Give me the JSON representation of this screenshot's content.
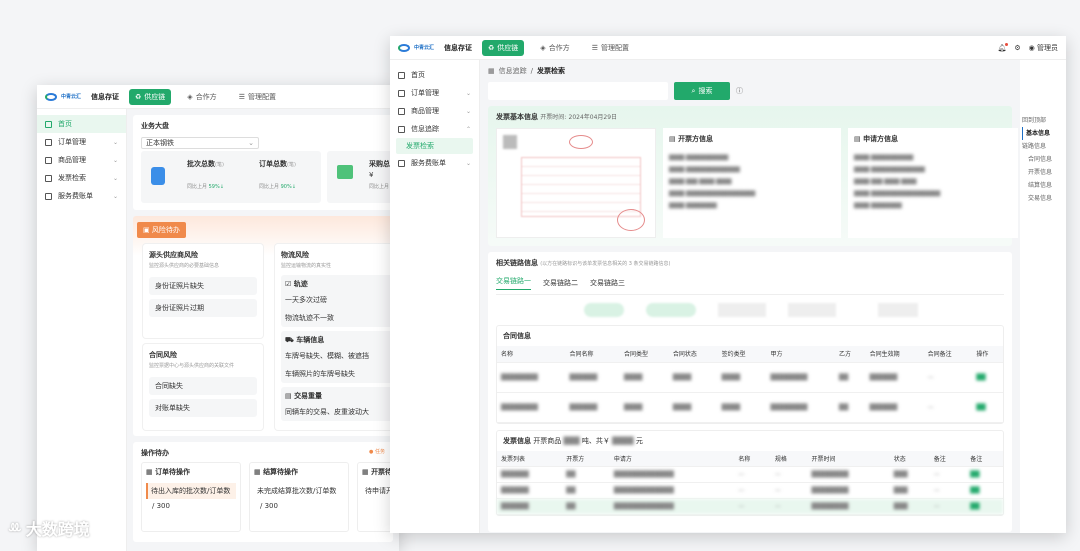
{
  "app": {
    "logo_text": "中青云汇",
    "logo_sub": "BlueSheep",
    "brand": "信息存证",
    "tabs": [
      "供应链",
      "合作方",
      "管理配置"
    ],
    "user": "管理员"
  },
  "w1": {
    "sidebar": [
      "首页",
      "订单管理",
      "商品管理",
      "发票检索",
      "服务费账单"
    ],
    "dashboard": {
      "title": "业务大盘",
      "select_value": "正本钢铁",
      "kpi1_label": "批次总数",
      "kpi1_unit": "(笔)",
      "kpi1_sub": "同比上月",
      "kpi1_pct": "59%",
      "kpi2_label": "订单总数",
      "kpi2_unit": "(笔)",
      "kpi2_sub": "同比上月",
      "kpi2_pct": "90%",
      "kpi3_label": "采购总",
      "kpi3_value": "¥",
      "kpi3_sub": "同比上月"
    },
    "risk": {
      "badge": "风险待办",
      "source_title": "源头供应商风险",
      "source_desc": "监控源头供应商的必要基础信息",
      "source_items": [
        "身份证照片缺失",
        "身份证照片过期"
      ],
      "logistics_title": "物流风险",
      "logistics_desc": "监控运输物流的真实性",
      "track_title": "轨迹",
      "track_items": [
        "一天多次过磅",
        "物流轨迹不一致"
      ],
      "vehicle_title": "车辆信息",
      "vehicle_items": [
        "车牌号缺失、模糊、被遮挡",
        "车辆照片的车牌号缺失"
      ],
      "trade_title": "交易重量",
      "trade_items": [
        "同辆车的交易、皮重波动大"
      ],
      "contract_title": "合同风险",
      "contract_desc": "监控票据中心与源头供应商的关联文件",
      "contract_items": [
        "合同缺失",
        "对账单缺失"
      ]
    },
    "ops": {
      "title": "操作待办",
      "right_label": "任务",
      "col1_title": "订单待操作",
      "col1_item": "待出入库的批次数/订单数",
      "col1_count": "/ 300",
      "col2_title": "结算待操作",
      "col2_item": "未完成结算批次数/订单数",
      "col2_count": "/ 300",
      "col3_title": "开票待",
      "col3_item": "待申请开票"
    }
  },
  "w2": {
    "sidebar": [
      "首页",
      "订单管理",
      "商品管理",
      "信息追踪",
      "发票检索",
      "服务费账单"
    ],
    "breadcrumb": [
      "信息追踪",
      "发票检索"
    ],
    "search_button": "搜索",
    "invoice": {
      "title": "发票基本信息",
      "time_label": "开票时间:",
      "time_value": "2024年04月29日",
      "issuer_title": "开票方信息",
      "applicant_title": "申请方信息"
    },
    "chain": {
      "title": "相关链路信息",
      "desc": "(以方在链路标识与该单发票信息相关的 3 条交易链路信息)",
      "tabs": [
        "交易链路一",
        "交易链路二",
        "交易链路三"
      ]
    },
    "contract": {
      "title": "合同信息",
      "headers": [
        "名称",
        "合同名称",
        "合同类型",
        "合同状态",
        "签约类型",
        "甲方",
        "乙方",
        "合同生效期",
        "合同备注",
        "操作"
      ]
    },
    "invoice_list": {
      "title": "发票信息",
      "goods_label": "开票商品",
      "total_prefix": "吨、共￥",
      "total_suffix": "元",
      "headers": [
        "发票列表",
        "开票方",
        "申请方",
        "名称",
        "规格",
        "开票时间",
        "状态",
        "备注",
        "备注"
      ]
    },
    "anchor_nav": [
      "回到顶部",
      "基本信息",
      "链路信息",
      "合同信息",
      "开票信息",
      "结算信息",
      "交易信息"
    ]
  },
  "watermark": "大数跨境",
  "colors": {
    "accent": "#22a96b",
    "risk": "#f08a4b",
    "link": "#1d6fc6"
  }
}
